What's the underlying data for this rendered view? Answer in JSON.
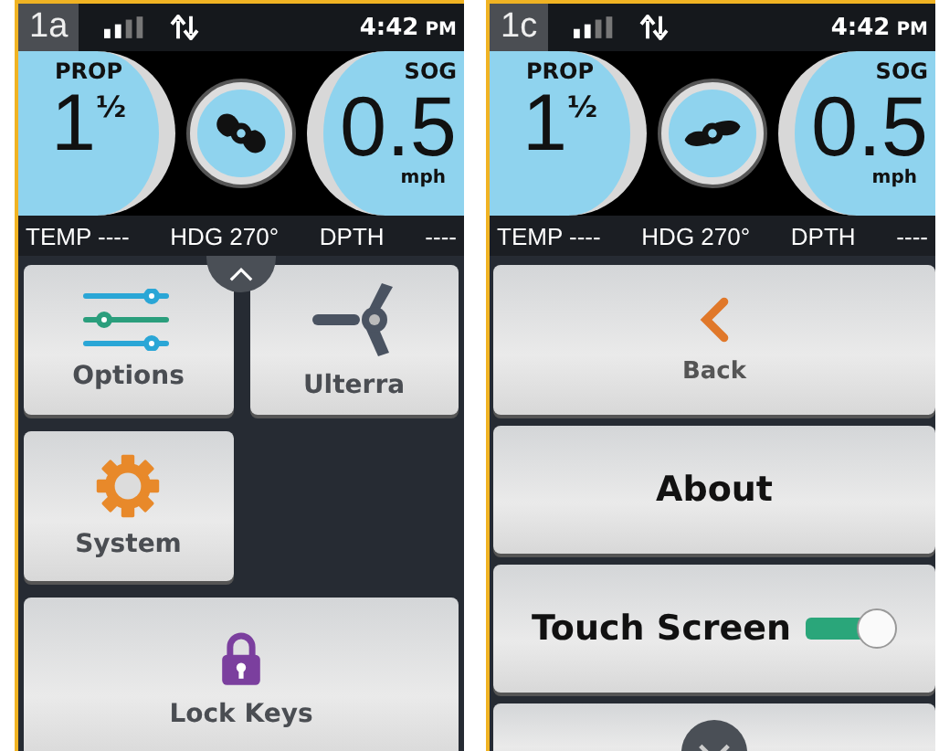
{
  "screens": [
    {
      "badge": "1a",
      "time": "4:42",
      "time_suffix": "PM",
      "prop": {
        "label": "PROP",
        "whole": "1",
        "fraction": "½"
      },
      "sog": {
        "label": "SOG",
        "value": "0.5",
        "unit": "mph"
      },
      "readouts": [
        "TEMP ----",
        "HDG 270°",
        "DPTH",
        "----"
      ],
      "menu": {
        "kind": "grid",
        "items": [
          {
            "kind": "tile",
            "label": "Options"
          },
          {
            "kind": "tile",
            "label": "Ulterra"
          },
          {
            "kind": "tile",
            "label": "System"
          },
          {
            "kind": "wide",
            "label": "Lock Keys"
          }
        ]
      }
    },
    {
      "badge": "1c",
      "time": "4:42",
      "time_suffix": "PM",
      "prop": {
        "label": "PROP",
        "whole": "1",
        "fraction": "½"
      },
      "sog": {
        "label": "SOG",
        "value": "0.5",
        "unit": "mph"
      },
      "readouts": [
        "TEMP ----",
        "HDG 270°",
        "DPTH",
        "----"
      ],
      "menu": {
        "kind": "list",
        "items": [
          {
            "kind": "back",
            "label": "Back"
          },
          {
            "kind": "row",
            "label": "About"
          },
          {
            "kind": "toggle",
            "label": "Touch Screen",
            "on": true
          },
          {
            "kind": "partial"
          }
        ]
      }
    }
  ]
}
